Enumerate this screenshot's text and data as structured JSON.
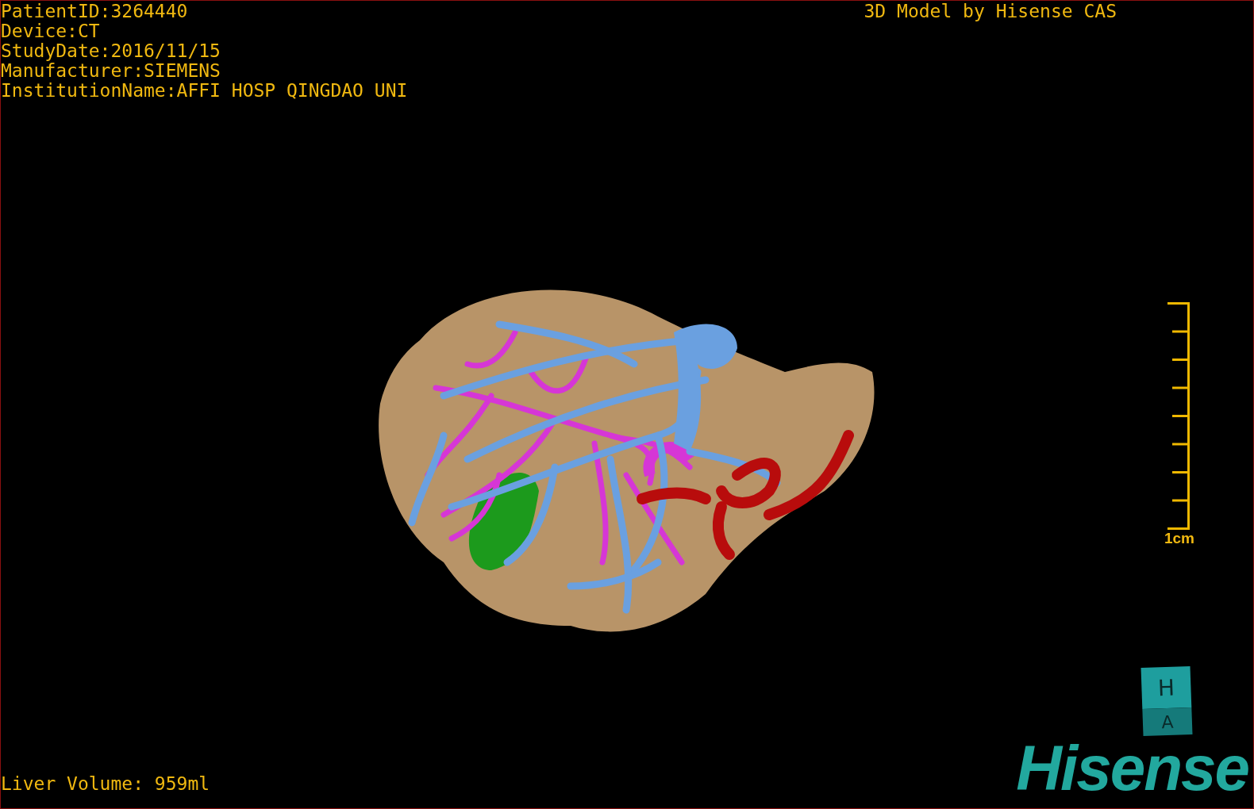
{
  "info_lines": [
    "PatientID:3264440",
    "Device:CT",
    "StudyDate:2016/11/15",
    "Manufacturer:SIEMENS",
    "InstitutionName:AFFI HOSP QINGDAO UNI"
  ],
  "title": "3D Model by Hisense CAS",
  "scale_bar": {
    "label": "1cm"
  },
  "orientation_cube": {
    "top_label": "H",
    "front_label": "A"
  },
  "liver_volume": "Liver Volume: 959ml",
  "logo": "Hisense"
}
